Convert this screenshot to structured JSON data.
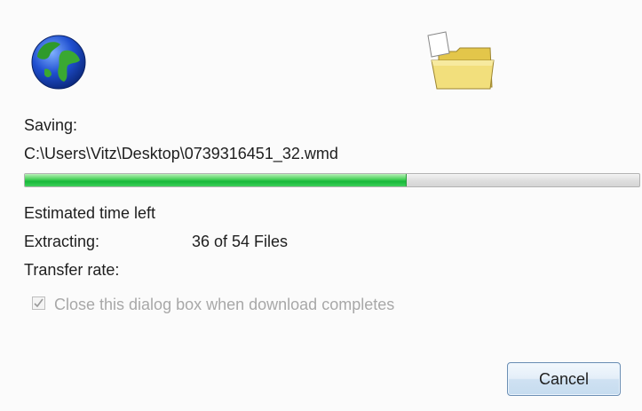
{
  "dialog": {
    "saving_label": "Saving:",
    "file_path": "C:\\Users\\Vitz\\Desktop\\0739316451_32.wmd",
    "progress": {
      "value": 0.62
    },
    "estimated_time_label": "Estimated time left",
    "extracting_label": "Extracting:",
    "extracting_value": "36 of 54 Files",
    "transfer_rate_label": "Transfer rate:",
    "close_checkbox": {
      "label": "Close this dialog box when download completes",
      "checked": true,
      "disabled": true
    },
    "cancel_label": "Cancel"
  },
  "icons": {
    "globe": "globe-icon",
    "folder": "folder-icon",
    "checkmark": "checkmark-icon"
  },
  "colors": {
    "progress_fill": "#17b83a",
    "button_border": "#6c8fb4",
    "disabled_text": "#a8a8a8"
  }
}
